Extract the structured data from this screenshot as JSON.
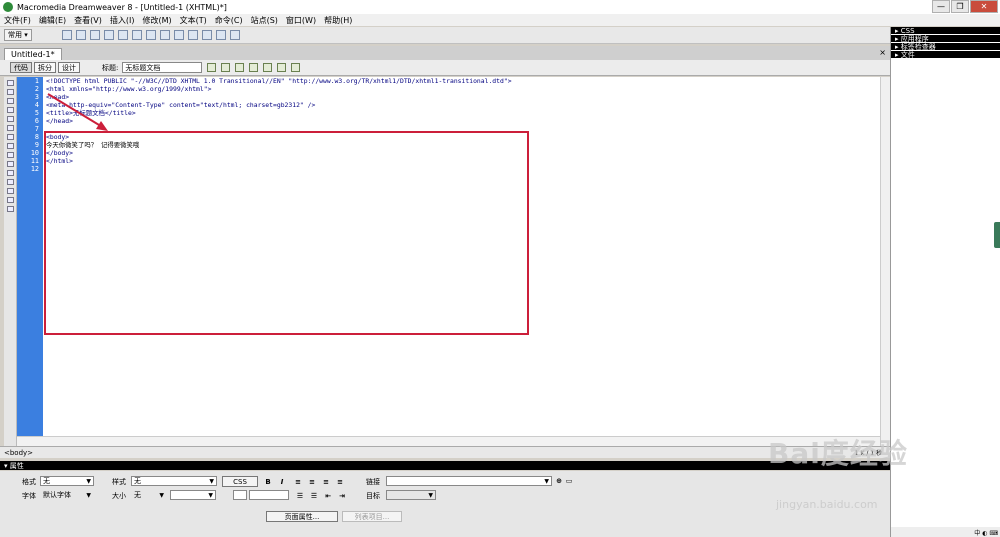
{
  "window": {
    "title": "Macromedia Dreamweaver 8 - [Untitled-1 (XHTML)*]",
    "min": "—",
    "max": "❐",
    "close": "✕"
  },
  "menu": [
    "文件(F)",
    "编辑(E)",
    "查看(V)",
    "插入(I)",
    "修改(M)",
    "文本(T)",
    "命令(C)",
    "站点(S)",
    "窗口(W)",
    "帮助(H)"
  ],
  "insert_bar": {
    "category": "常用"
  },
  "panels": [
    "CSS",
    "应用程序",
    "标签检查器",
    "文件"
  ],
  "document": {
    "tab": "Untitled-1*",
    "close": "×",
    "view_buttons": {
      "code": "代码",
      "split": "拆分",
      "design": "设计"
    },
    "title_label": "标题:",
    "title_value": "无标题文档"
  },
  "code_lines": [
    "<!DOCTYPE html PUBLIC \"-//W3C//DTD XHTML 1.0 Transitional//EN\" \"http://www.w3.org/TR/xhtml1/DTD/xhtml1-transitional.dtd\">",
    "<html xmlns=\"http://www.w3.org/1999/xhtml\">",
    "<head>",
    "<meta http-equiv=\"Content-Type\" content=\"text/html; charset=gb2312\" />",
    "<title>无标题文档</title>",
    "</head>",
    "",
    "<body>",
    "今天你微笑了吗？ 记得要微笑哦",
    "</body>",
    "</html>",
    ""
  ],
  "line_numbers": [
    "1",
    "2",
    "3",
    "4",
    "5",
    "6",
    "7",
    "8",
    "9",
    "10",
    "11",
    "12"
  ],
  "status": {
    "tag": "<body>",
    "right": "1 K / 1 秒"
  },
  "properties": {
    "header": "属性",
    "format_label": "格式",
    "format_value": "无",
    "style_label": "样式",
    "style_value": "无",
    "css_button": "CSS",
    "bold": "B",
    "italic": "I",
    "link_label": "链接",
    "font_label": "字体",
    "font_value": "默认字体",
    "size_label": "大小",
    "size_value": "无",
    "target_label": "目标",
    "page_props": "页面属性...",
    "list_item": "列表项目..."
  },
  "watermark": {
    "brand": "Bai度经验",
    "url": "jingyan.baidu.com"
  },
  "annotation_color": "#cc1f3a",
  "gutter_color": "#3b7fe0"
}
